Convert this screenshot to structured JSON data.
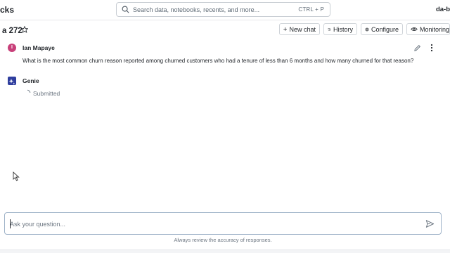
{
  "header": {
    "brand": "cks",
    "search_placeholder": "Search data, notebooks, recents, and more...",
    "search_shortcut": "CTRL + P",
    "workspace": "da-b"
  },
  "page": {
    "title": "a 272"
  },
  "toolbar": {
    "new_chat": "New chat",
    "history": "History",
    "configure": "Configure",
    "monitoring": "Monitoring"
  },
  "conversation": {
    "user": {
      "initial": "I",
      "name": "Ian Mapaye",
      "question": "What is the most common churn reason reported among churned customers who had a tenure of less than 6 months and how many churned for that reason?"
    },
    "assistant": {
      "name": "Genie",
      "status": "Submitted"
    }
  },
  "input": {
    "placeholder": "Ask your question...",
    "value": ""
  },
  "footer": {
    "disclaimer": "Always review the accuracy of responses."
  },
  "colors": {
    "user_avatar": "#c8407a",
    "genie_avatar": "#2f3e9e",
    "input_border": "#9fb3c8"
  }
}
